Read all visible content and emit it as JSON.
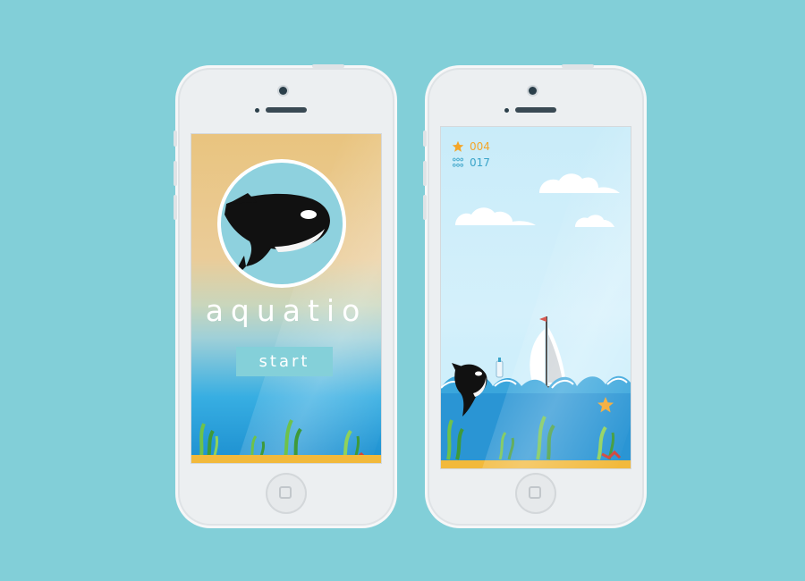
{
  "menu_screen": {
    "title": "aquatio",
    "start_label": "start"
  },
  "game_screen": {
    "hud": {
      "starfish_count": "004",
      "bubbles_count": "017"
    }
  },
  "colors": {
    "background": "#82cfd8",
    "accent": "#f4a62a",
    "water": "#2a95d4",
    "sand": "#f2b93b"
  },
  "icons": [
    "orca-logo",
    "starfish-icon",
    "bubbles-icon",
    "sailboat",
    "orca",
    "bottle",
    "starfish",
    "seaweed",
    "clouds"
  ]
}
